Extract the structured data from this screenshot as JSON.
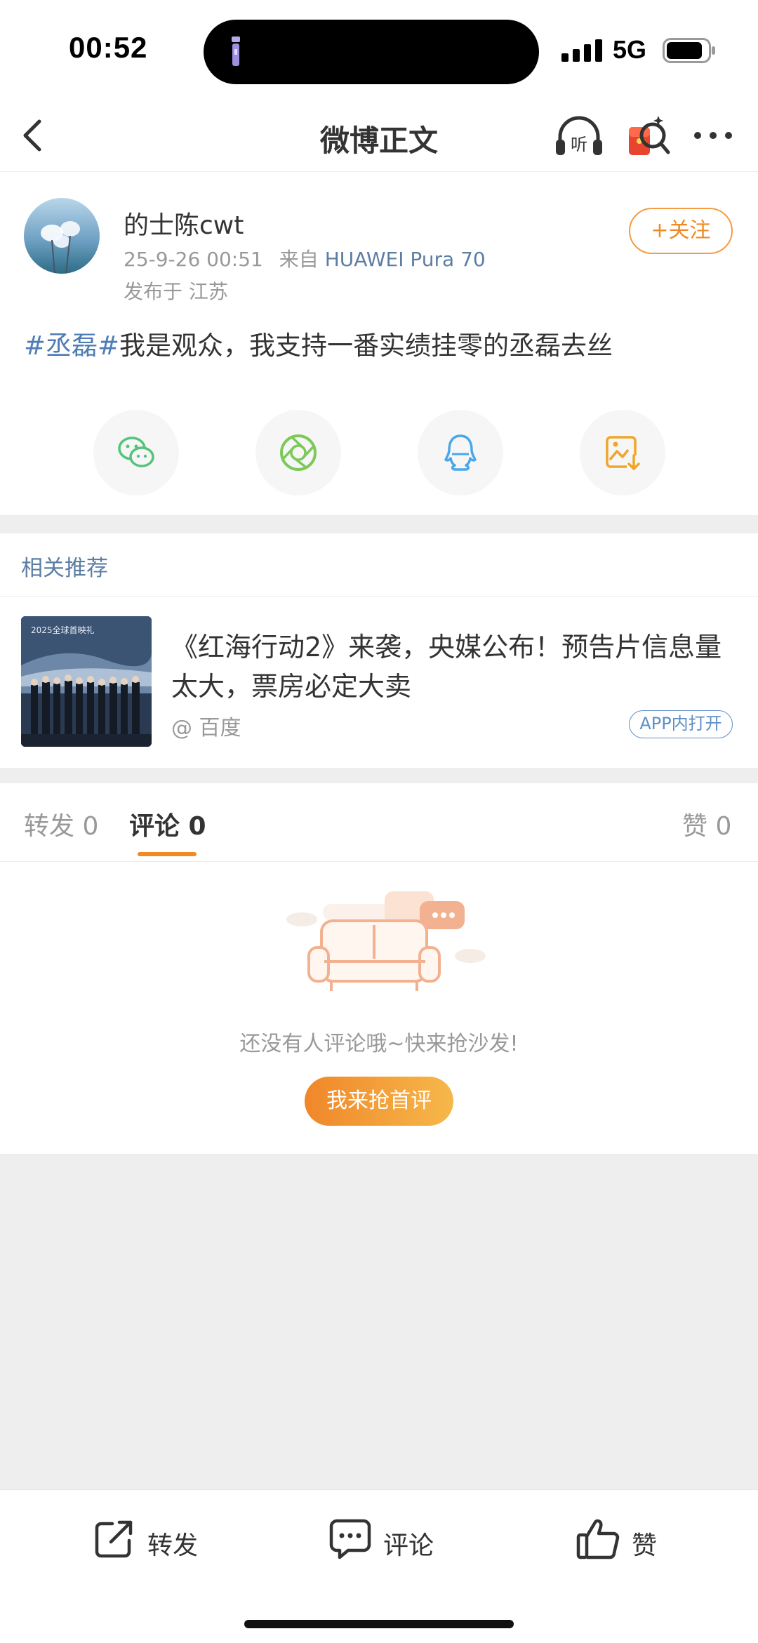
{
  "status_bar": {
    "time": "00:52",
    "network": "5G"
  },
  "nav": {
    "title": "微博正文"
  },
  "post": {
    "username": "的士陈cwt",
    "date": "25-9-26 00:51",
    "source_prefix": "来自",
    "source": "HUAWEI Pura 70",
    "location": "发布于 江苏",
    "follow_label": "+关注",
    "hashtag": "#丞磊#",
    "text": "我是观众，我支持一番实绩挂零的丞磊去丝"
  },
  "share": [
    "wechat-icon",
    "moments-icon",
    "qq-icon",
    "save-image-icon"
  ],
  "recommend": {
    "section_title": "相关推荐",
    "headline": "《红海行动2》来袭，央媒公布！预告片信息量太大，票房必定大卖",
    "source": "@ 百度",
    "open_label": "APP内打开",
    "thumb_caption": "2025全球首映礼"
  },
  "tabs": {
    "repost": "转发 0",
    "comment": "评论 0",
    "like": "赞 0"
  },
  "empty": {
    "text": "还没有人评论哦~快来抢沙发!",
    "button": "我来抢首评"
  },
  "bottom_bar": {
    "repost": "转发",
    "comment": "评论",
    "like": "赞"
  },
  "colors": {
    "accent": "#f08a24",
    "link": "#5d7ea3"
  }
}
